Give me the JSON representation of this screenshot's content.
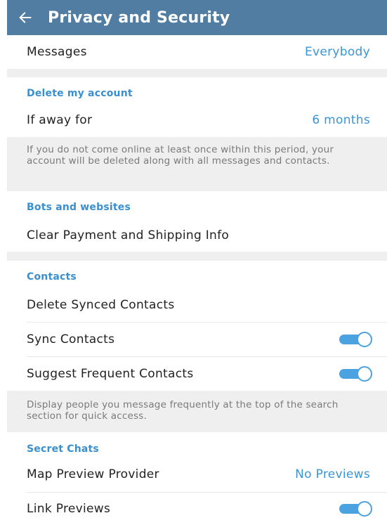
{
  "header": {
    "back_icon": "arrow-left-icon",
    "title": "Privacy and Security",
    "background_color": "#517da2"
  },
  "messages_row": {
    "label": "Messages",
    "value": "Everybody"
  },
  "delete_account": {
    "header": "Delete my account",
    "if_away": {
      "label": "If away for",
      "value": "6 months"
    },
    "info": "If you do not come online at least once within this period, your account will be deleted along with all messages and contacts."
  },
  "bots": {
    "header": "Bots and websites",
    "clear_payment": "Clear Payment and Shipping Info"
  },
  "contacts": {
    "header": "Contacts",
    "delete_synced": "Delete Synced Contacts",
    "sync_contacts": {
      "label": "Sync Contacts",
      "enabled": true
    },
    "suggest_frequent": {
      "label": "Suggest Frequent Contacts",
      "enabled": true
    },
    "info": "Display people you message frequently at the top of the search section for quick access."
  },
  "secret_chats": {
    "header": "Secret Chats",
    "map_preview": {
      "label": "Map Preview Provider",
      "value": "No Previews"
    },
    "link_previews": {
      "label": "Link Previews",
      "enabled": true
    }
  },
  "colors": {
    "accent": "#3a95d5",
    "toggle_on": "#4aa3e0",
    "section_gap": "#efefef"
  }
}
